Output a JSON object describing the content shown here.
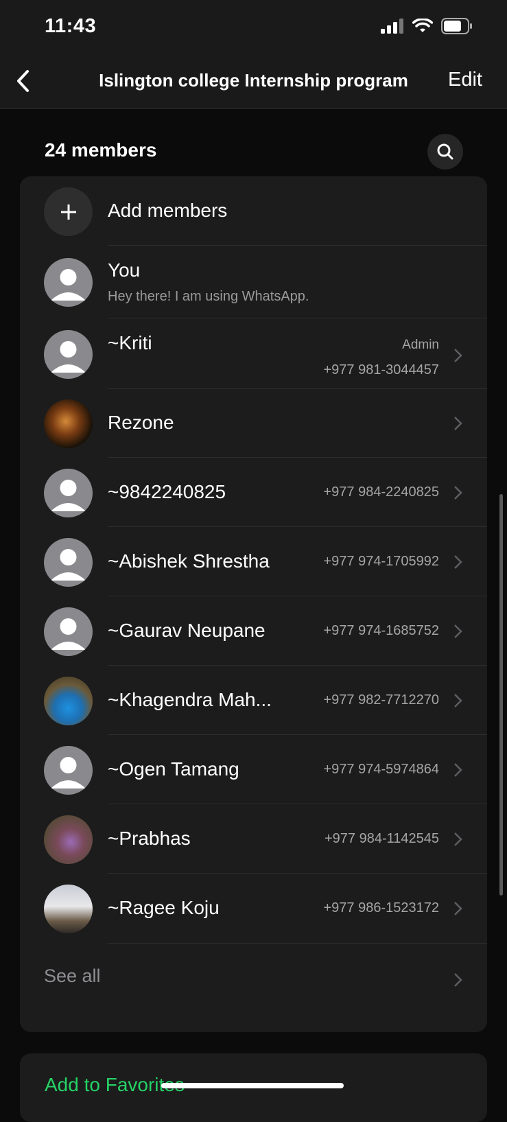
{
  "status": {
    "time": "11:43"
  },
  "nav": {
    "title": "Islington college Internship program",
    "edit": "Edit"
  },
  "members": {
    "count_label": "24 members",
    "add_label": "Add members",
    "you": {
      "name": "You",
      "status": "Hey there! I am using WhatsApp."
    },
    "list": [
      {
        "name": "~Kriti",
        "phone": "+977 981-3044457",
        "badge": "Admin",
        "avatar": "default-avatar"
      },
      {
        "name": "Rezone",
        "phone": "",
        "badge": "",
        "avatar": "photo-avatar"
      },
      {
        "name": "~9842240825",
        "phone": "+977 984-2240825",
        "badge": "",
        "avatar": "default-avatar"
      },
      {
        "name": "~Abishek Shrestha",
        "phone": "+977 974-1705992",
        "badge": "",
        "avatar": "default-avatar"
      },
      {
        "name": "~Gaurav Neupane",
        "phone": "+977 974-1685752",
        "badge": "",
        "avatar": "default-avatar"
      },
      {
        "name": "~Khagendra Mah...",
        "phone": "+977 982-7712270",
        "badge": "",
        "avatar": "photo-avatar"
      },
      {
        "name": "~Ogen Tamang",
        "phone": "+977 974-5974864",
        "badge": "",
        "avatar": "default-avatar"
      },
      {
        "name": "~Prabhas",
        "phone": "+977 984-1142545",
        "badge": "",
        "avatar": "photo-avatar"
      },
      {
        "name": "~Ragee Koju",
        "phone": "+977 986-1523172",
        "badge": "",
        "avatar": "photo-avatar"
      }
    ],
    "see_all": "See all"
  },
  "favorites": {
    "label": "Add to Favorites"
  },
  "colors": {
    "accent": "#25d366",
    "background": "#0b0b0b",
    "card": "#1c1c1c"
  }
}
